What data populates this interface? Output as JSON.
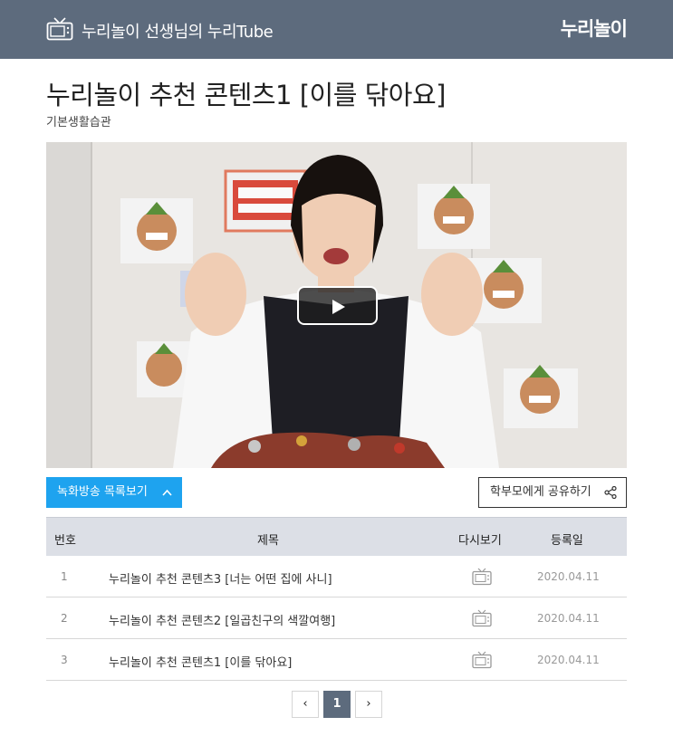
{
  "header": {
    "title": "누리놀이 선생님의 누리Tube",
    "logo_text": "누리놀이"
  },
  "content": {
    "title": "누리놀이 추천 콘텐츠1 [이를 닦아요]",
    "category": "기본생활습관"
  },
  "controls": {
    "list_toggle_label": "녹화방송 목록보기",
    "share_label": "학부모에게 공유하기"
  },
  "table": {
    "headers": [
      "번호",
      "제목",
      "다시보기",
      "등록일"
    ],
    "rows": [
      {
        "num": "1",
        "title": "누리놀이 추천 콘텐츠3 [너는 어떤 집에 사니]",
        "date": "2020.04.11"
      },
      {
        "num": "2",
        "title": "누리놀이 추천 콘텐츠2 [일곱친구의 색깔여행]",
        "date": "2020.04.11"
      },
      {
        "num": "3",
        "title": "누리놀이 추천 콘텐츠1 [이를 닦아요]",
        "date": "2020.04.11"
      }
    ]
  },
  "pagination": {
    "prev": "‹",
    "current": "1",
    "next": "›"
  },
  "icons": [
    "tv-icon",
    "play-icon",
    "chevron-up-icon",
    "share-icon",
    "replay-tv-icon"
  ],
  "colors": {
    "header_bg": "#5d6b7d",
    "accent": "#1ea3ef",
    "table_header_bg": "#dcdfe6"
  }
}
